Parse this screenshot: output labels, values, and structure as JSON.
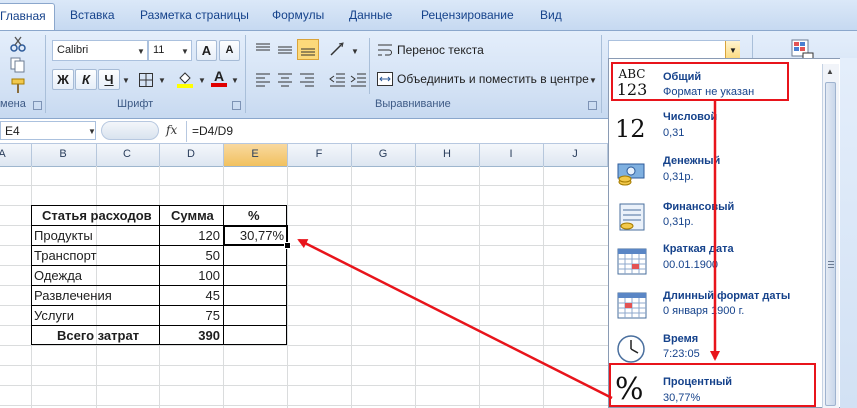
{
  "tabs": [
    "Главная",
    "Вставка",
    "Разметка страницы",
    "Формулы",
    "Данные",
    "Рецензирование",
    "Вид"
  ],
  "clipboard": {
    "label": "мена"
  },
  "font": {
    "name": "Calibri",
    "size": "11",
    "group_label": "Шрифт",
    "grow": "A",
    "shrink": "A",
    "bold": "Ж",
    "italic": "К",
    "underline": "Ч",
    "fontcolor_letter": "A"
  },
  "alignment": {
    "wrap_label": "Перенос текста",
    "merge_label": "Объединить и поместить в центре",
    "group_label": "Выравнивание"
  },
  "number_format_box": {
    "value": ""
  },
  "right_group": {
    "label": "С"
  },
  "formula_bar": {
    "name_box": "E4",
    "fx": "fx",
    "formula": "=D4/D9"
  },
  "grid": {
    "columns": [
      "A",
      "B",
      "C",
      "D",
      "E",
      "F",
      "G",
      "H",
      "I",
      "J"
    ],
    "headers": {
      "b": "Статья расходов",
      "d": "Сумма",
      "e": "%"
    },
    "rows": [
      {
        "label": "Продукты",
        "value": "120",
        "pct": "30,77%"
      },
      {
        "label": "Транспорт",
        "value": "50",
        "pct": ""
      },
      {
        "label": "Одежда",
        "value": "100",
        "pct": ""
      },
      {
        "label": "Развлечения",
        "value": "45",
        "pct": ""
      },
      {
        "label": "Услуги",
        "value": "75",
        "pct": ""
      }
    ],
    "total": {
      "label": "Всего затрат",
      "value": "390"
    }
  },
  "formats": [
    {
      "title": "Общий",
      "sample": "Формат не указан",
      "icon": "general-icon",
      "icon_text_top": "ABC",
      "icon_text_bottom": "123"
    },
    {
      "title": "Числовой",
      "sample": "0,31",
      "icon": "number-icon",
      "icon_text_top": "12"
    },
    {
      "title": "Денежный",
      "sample": "0,31р.",
      "icon": "currency-icon"
    },
    {
      "title": "Финансовый",
      "sample": " 0,31р.",
      "icon": "accounting-icon"
    },
    {
      "title": "Краткая дата",
      "sample": "00.01.1900",
      "icon": "short-date-icon"
    },
    {
      "title": "Длинный формат даты",
      "sample": "0 января 1900 г.",
      "icon": "long-date-icon"
    },
    {
      "title": "Время",
      "sample": "7:23:05",
      "icon": "time-icon"
    },
    {
      "title": "Процентный",
      "sample": "30,77%",
      "icon": "percent-icon",
      "icon_text_top": "%"
    }
  ],
  "colors": {
    "highlight": "#e8141b",
    "ribbon_text": "#15428b",
    "selection": "#000000"
  }
}
